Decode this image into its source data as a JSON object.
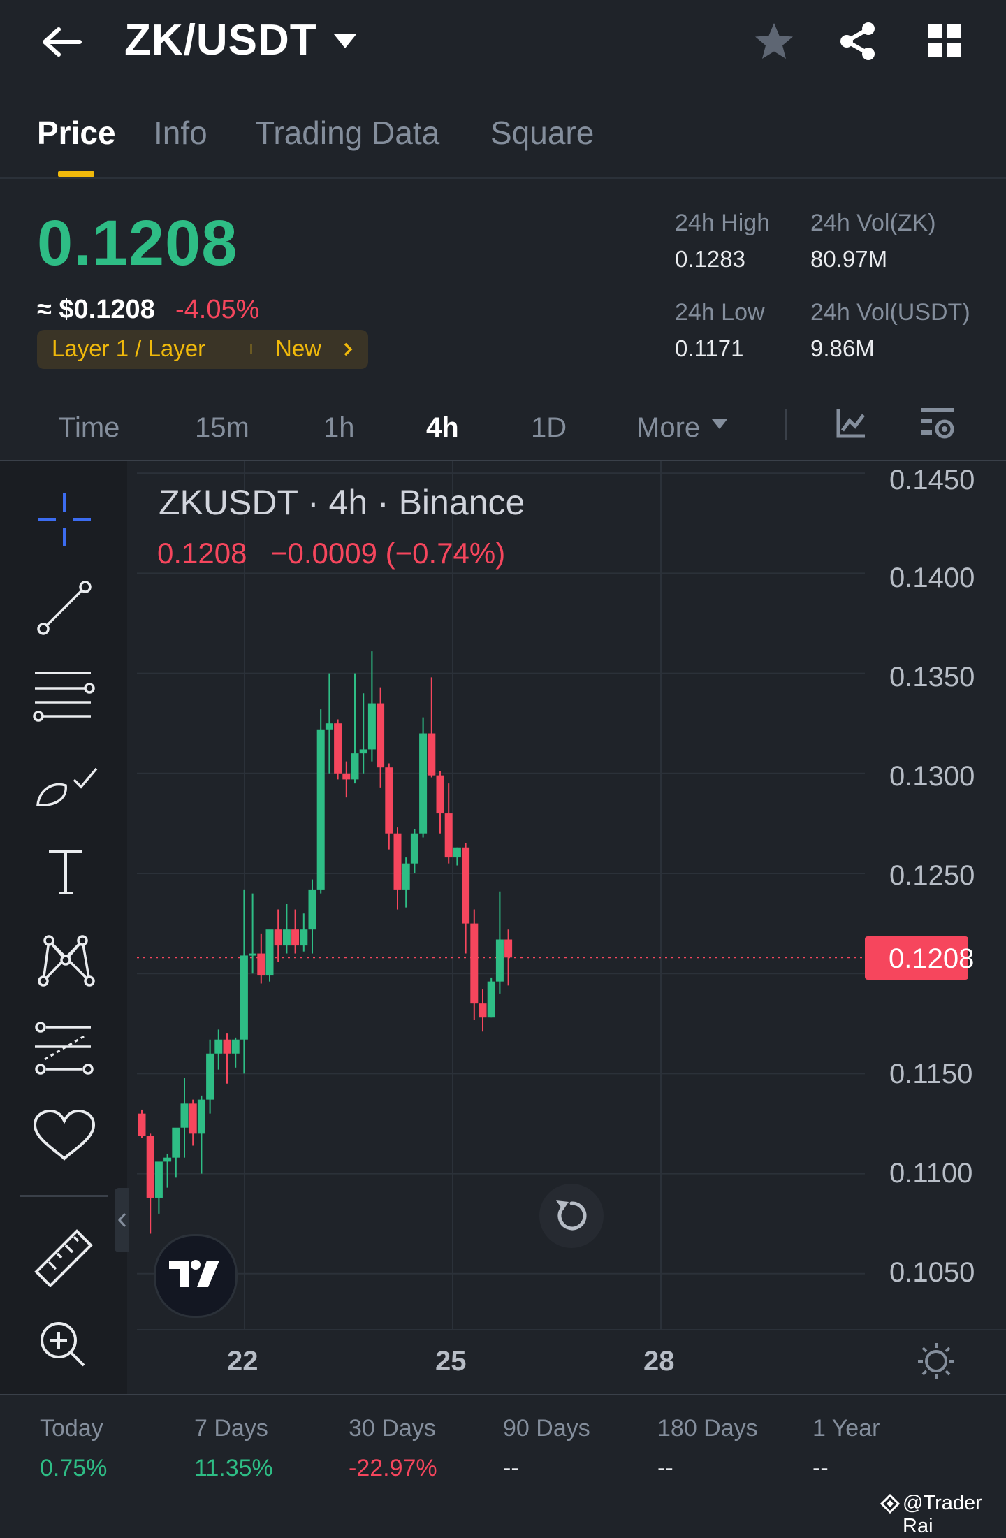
{
  "header": {
    "pair": "ZK/USDT",
    "icons": [
      "back-arrow-icon",
      "caret-down-icon",
      "star-icon",
      "share-icon",
      "grid-icon"
    ]
  },
  "tabs": [
    {
      "label": "Price",
      "active": true
    },
    {
      "label": "Info"
    },
    {
      "label": "Trading Data"
    },
    {
      "label": "Square"
    }
  ],
  "price": {
    "last": "0.1208",
    "usd": "≈ $0.1208",
    "change_pct": "-4.05%",
    "tag_category": "Layer 1 / Layer",
    "tag_new": "New",
    "high_label": "24h High",
    "high": "0.1283",
    "low_label": "24h Low",
    "low": "0.1171",
    "vol_base_label": "24h Vol(ZK)",
    "vol_base": "80.97M",
    "vol_quote_label": "24h Vol(USDT)",
    "vol_quote": "9.86M"
  },
  "intervals": [
    {
      "label": "Time"
    },
    {
      "label": "15m"
    },
    {
      "label": "1h"
    },
    {
      "label": "4h",
      "active": true
    },
    {
      "label": "1D"
    },
    {
      "label": "More"
    }
  ],
  "toolbar_icons": [
    "crosshair-icon",
    "trendline-icon",
    "horizontal-lines-icon",
    "brush-icon",
    "text-icon",
    "pattern-icon",
    "fib-icon",
    "heart-icon",
    "ruler-icon",
    "zoom-in-icon"
  ],
  "chart": {
    "title": "ZKUSDT · 4h · Binance",
    "ohlc_close": "0.1208",
    "ohlc_change": "−0.0009 (−0.74%)",
    "current_price_label": "0.1208"
  },
  "chart_data": {
    "type": "candlestick",
    "title": "ZKUSDT · 4h · Binance",
    "x_ticks": [
      "22",
      "25",
      "28"
    ],
    "y_ticks": [
      "0.1450",
      "0.1400",
      "0.1350",
      "0.1300",
      "0.1250",
      "0.1150",
      "0.1100",
      "0.1050"
    ],
    "ylim": [
      0.1022,
      0.1456
    ],
    "current_price": 0.1208,
    "colors": {
      "up": "#2ebd85",
      "down": "#f6465d"
    },
    "candles": [
      {
        "o": 0.113,
        "h": 0.1132,
        "l": 0.1118,
        "c": 0.1119
      },
      {
        "o": 0.1119,
        "h": 0.112,
        "l": 0.107,
        "c": 0.1088
      },
      {
        "o": 0.1088,
        "h": 0.1105,
        "l": 0.108,
        "c": 0.1106
      },
      {
        "o": 0.1106,
        "h": 0.111,
        "l": 0.1093,
        "c": 0.1108
      },
      {
        "o": 0.1108,
        "h": 0.112,
        "l": 0.1098,
        "c": 0.1123
      },
      {
        "o": 0.1123,
        "h": 0.1148,
        "l": 0.1108,
        "c": 0.1135
      },
      {
        "o": 0.1135,
        "h": 0.1137,
        "l": 0.1114,
        "c": 0.112
      },
      {
        "o": 0.112,
        "h": 0.1139,
        "l": 0.11,
        "c": 0.1137
      },
      {
        "o": 0.1137,
        "h": 0.1167,
        "l": 0.113,
        "c": 0.116
      },
      {
        "o": 0.116,
        "h": 0.1172,
        "l": 0.1152,
        "c": 0.1167
      },
      {
        "o": 0.1167,
        "h": 0.117,
        "l": 0.1145,
        "c": 0.116
      },
      {
        "o": 0.116,
        "h": 0.1168,
        "l": 0.1153,
        "c": 0.1167
      },
      {
        "o": 0.1167,
        "h": 0.1242,
        "l": 0.115,
        "c": 0.1209
      },
      {
        "o": 0.1209,
        "h": 0.124,
        "l": 0.12,
        "c": 0.121
      },
      {
        "o": 0.121,
        "h": 0.122,
        "l": 0.1195,
        "c": 0.1199
      },
      {
        "o": 0.1199,
        "h": 0.1215,
        "l": 0.1196,
        "c": 0.1222
      },
      {
        "o": 0.1222,
        "h": 0.1232,
        "l": 0.1206,
        "c": 0.1214
      },
      {
        "o": 0.1214,
        "h": 0.1235,
        "l": 0.121,
        "c": 0.1222
      },
      {
        "o": 0.1222,
        "h": 0.1232,
        "l": 0.121,
        "c": 0.1214
      },
      {
        "o": 0.1214,
        "h": 0.123,
        "l": 0.1211,
        "c": 0.1222
      },
      {
        "o": 0.1222,
        "h": 0.1247,
        "l": 0.121,
        "c": 0.1242
      },
      {
        "o": 0.1242,
        "h": 0.1332,
        "l": 0.124,
        "c": 0.1322
      },
      {
        "o": 0.1322,
        "h": 0.135,
        "l": 0.13,
        "c": 0.1325
      },
      {
        "o": 0.1325,
        "h": 0.1327,
        "l": 0.1297,
        "c": 0.13
      },
      {
        "o": 0.13,
        "h": 0.1306,
        "l": 0.1288,
        "c": 0.1297
      },
      {
        "o": 0.1297,
        "h": 0.135,
        "l": 0.1295,
        "c": 0.131
      },
      {
        "o": 0.131,
        "h": 0.134,
        "l": 0.13,
        "c": 0.1312
      },
      {
        "o": 0.1312,
        "h": 0.1361,
        "l": 0.1306,
        "c": 0.1335
      },
      {
        "o": 0.1335,
        "h": 0.1343,
        "l": 0.1293,
        "c": 0.1303
      },
      {
        "o": 0.1303,
        "h": 0.1305,
        "l": 0.1262,
        "c": 0.127
      },
      {
        "o": 0.127,
        "h": 0.1273,
        "l": 0.1232,
        "c": 0.1242
      },
      {
        "o": 0.1242,
        "h": 0.1258,
        "l": 0.1233,
        "c": 0.1255
      },
      {
        "o": 0.1255,
        "h": 0.1272,
        "l": 0.125,
        "c": 0.127
      },
      {
        "o": 0.127,
        "h": 0.1328,
        "l": 0.1268,
        "c": 0.132
      },
      {
        "o": 0.132,
        "h": 0.1348,
        "l": 0.1298,
        "c": 0.1299
      },
      {
        "o": 0.1299,
        "h": 0.1301,
        "l": 0.127,
        "c": 0.128
      },
      {
        "o": 0.128,
        "h": 0.1295,
        "l": 0.1255,
        "c": 0.1258
      },
      {
        "o": 0.1258,
        "h": 0.1263,
        "l": 0.1254,
        "c": 0.1263
      },
      {
        "o": 0.1263,
        "h": 0.1265,
        "l": 0.121,
        "c": 0.1225
      },
      {
        "o": 0.1225,
        "h": 0.1232,
        "l": 0.1177,
        "c": 0.1185
      },
      {
        "o": 0.1185,
        "h": 0.1192,
        "l": 0.1171,
        "c": 0.1178
      },
      {
        "o": 0.1178,
        "h": 0.1198,
        "l": 0.1178,
        "c": 0.1196
      },
      {
        "o": 0.1196,
        "h": 0.1241,
        "l": 0.119,
        "c": 0.1217
      },
      {
        "o": 0.1217,
        "h": 0.1222,
        "l": 0.1194,
        "c": 0.1208
      }
    ]
  },
  "periods": [
    {
      "label": "Today",
      "value": "0.75%",
      "color": "#2ebd85"
    },
    {
      "label": "7 Days",
      "value": "11.35%",
      "color": "#2ebd85"
    },
    {
      "label": "30 Days",
      "value": "-22.97%",
      "color": "#f6465d"
    },
    {
      "label": "90 Days",
      "value": "--",
      "color": "#eaecef"
    },
    {
      "label": "180 Days",
      "value": "--",
      "color": "#eaecef"
    },
    {
      "label": "1 Year",
      "value": "--",
      "color": "#eaecef"
    }
  ],
  "watermark": "@Trader Rai"
}
